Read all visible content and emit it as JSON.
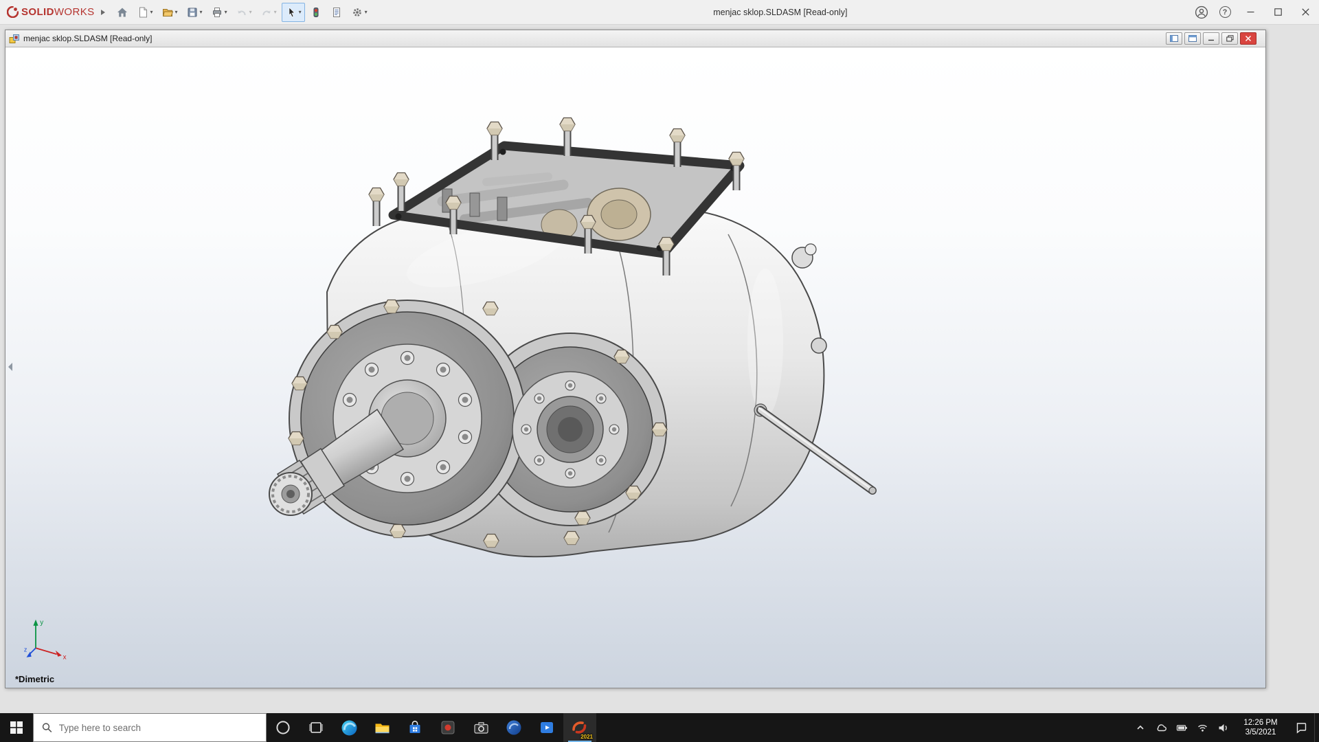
{
  "app": {
    "brand_bold": "SOLID",
    "brand_light": "WORKS",
    "window_title": "menjac sklop.SLDASM [Read-only]"
  },
  "icons": {
    "dropdown_caret": "▾",
    "help_glyph": "?"
  },
  "doc_window": {
    "title": "menjac sklop.SLDASM [Read-only]",
    "view_orientation_label": "*Dimetric",
    "triad": {
      "x_label": "x",
      "y_label": "y",
      "z_label": "z"
    },
    "model_description": "Gearbox assembly (two-bore front plate with bolted bearing covers, splined input shaft, open top cover with studs and gears)"
  },
  "taskbar": {
    "search_placeholder": "Type here to search",
    "clock_time": "12:26 PM",
    "clock_date": "3/5/2021",
    "solidworks_badge": "2021"
  },
  "colors": {
    "titlebar_bg": "#f0f0f0",
    "brand_red": "#b5342f",
    "selected_tool_bg": "#dcebfb",
    "doc_close_red": "#d94540",
    "taskbar_bg": "#161616",
    "taskbar_active_underline": "#76b9ed",
    "viewport_gradient_top": "#ffffff",
    "viewport_gradient_bottom": "#ccd4df"
  }
}
